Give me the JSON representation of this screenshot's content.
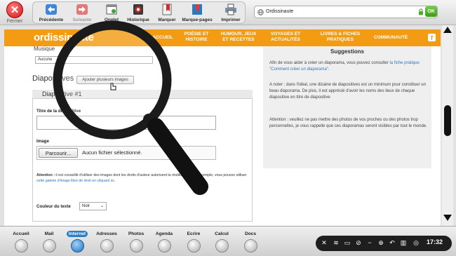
{
  "toolbar": {
    "close_label": "Fermer",
    "tools": [
      {
        "label": "Précédente",
        "icon": "back-arrow-icon"
      },
      {
        "label": "Suivante",
        "icon": "forward-arrow-icon"
      },
      {
        "label": "Onglet",
        "icon": "tab-icon"
      },
      {
        "label": "Historique",
        "icon": "history-icon"
      },
      {
        "label": "Marquer",
        "icon": "bookmark-icon"
      },
      {
        "label": "Marque-pages",
        "icon": "bookmarks-icon"
      },
      {
        "label": "Imprimer",
        "icon": "printer-icon"
      }
    ],
    "address": "Ordissinaute",
    "ok_label": "OK"
  },
  "site": {
    "logo": "ordissinaute",
    "nav": [
      {
        "label": "ACCUEIL"
      },
      {
        "label": "POÉSIE ET HISTOIRE"
      },
      {
        "label": "HUMOUR, JEUX ET RECETTES"
      },
      {
        "label": "VOYAGES ET ACTUALITÉS"
      },
      {
        "label": "LIVRES & FICHES PRATIQUES"
      },
      {
        "label": "COMMUNAUTÉ"
      }
    ],
    "fb_icon": "f"
  },
  "form": {
    "musique_label": "Musique",
    "musique_value": "Aucune",
    "diapos_title": "Diapositives",
    "add_images_label": "Ajouter plusieurs images",
    "diapo_header": "Diapositive #1",
    "titre_label": "Titre de la diapositive",
    "titre_value": "",
    "image_label": "Image",
    "browse_label": "Parcourir...",
    "file_status": "Aucun fichier sélectionné.",
    "attention_bold": "Attention :",
    "attention_text": " il est conseillé d'utiliser des images dont les droits d'auteur autorisent la réutilisation. Par exemple, vous pouvez utiliser ",
    "attention_link": "cette galerie d'image libre de droit en cliquant ici",
    "attention_end": ".",
    "couleur_label": "Couleur du texte",
    "couleur_value": "Noir"
  },
  "sidebar": {
    "title": "Suggestions",
    "p1_text": "Afin de vous aider à créer un diaporama, vous pouvez consulter ",
    "p1_link": "la fiche pratique \"Comment créer un diaporama\"",
    "p1_end": ".",
    "p2": "A noter : dans l'idéal, une dizaine de diapositives est un minimum pour constituer un beau diaporama. De plus, il est apprécié d'avoir les noms des lieux de chaque diapositive en titre de diapositive",
    "p3": "Attention : veuillez ne pas mettre des photos de vos proches ou des photos trop personnelles, je vous rappelle que ces diaporamas seront visibles par tout le monde."
  },
  "dock": {
    "apps": [
      {
        "label": "Accueil",
        "icon": "home-icon"
      },
      {
        "label": "Mail",
        "icon": "mail-icon"
      },
      {
        "label": "Internet",
        "icon": "globe-icon",
        "active": true
      },
      {
        "label": "Adresses",
        "icon": "contacts-icon"
      },
      {
        "label": "Photos",
        "icon": "photos-icon"
      },
      {
        "label": "Agenda",
        "icon": "calendar-icon"
      },
      {
        "label": "Ecrire",
        "icon": "write-icon"
      },
      {
        "label": "Calcul",
        "icon": "calculator-icon"
      },
      {
        "label": "Docs",
        "icon": "documents-icon"
      }
    ],
    "clock": "17:32"
  },
  "colors": {
    "accent_orange": "#f39c13",
    "link_blue": "#2a75c5",
    "dock_active": "#2d7fc9",
    "close_red": "#d01919"
  }
}
